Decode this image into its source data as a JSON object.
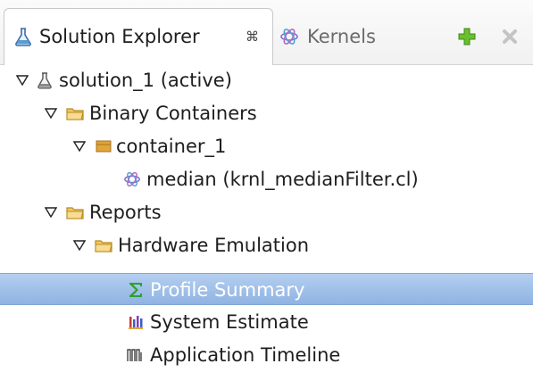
{
  "tabs": {
    "solution_explorer": {
      "label": "Solution Explorer",
      "close_glyph": "⌘"
    },
    "kernels": {
      "label": "Kernels"
    }
  },
  "toolbar": {
    "add_icon": "plus-icon",
    "remove_icon": "remove-icon"
  },
  "tree": {
    "items": [
      {
        "label": "solution_1 (active)",
        "icon": "flask-icon",
        "expanded": true
      },
      {
        "label": "Binary Containers",
        "icon": "folder-icon",
        "expanded": true
      },
      {
        "label": "container_1",
        "icon": "container-icon",
        "expanded": true
      },
      {
        "label": "median (krnl_medianFilter.cl)",
        "icon": "kernel-icon"
      },
      {
        "label": "Reports",
        "icon": "folder-icon",
        "expanded": true
      },
      {
        "label": "Hardware Emulation",
        "icon": "folder-icon",
        "expanded": true
      },
      {
        "label": "Profile Summary",
        "icon": "sigma-icon",
        "selected": true
      },
      {
        "label": "System Estimate",
        "icon": "bar-chart-icon"
      },
      {
        "label": "Application Timeline",
        "icon": "timeline-icon"
      }
    ]
  },
  "colors": {
    "selection": "#9dbde8",
    "folder": "#f0c96a",
    "container": "#e0a63a",
    "sigma": "#2da12d",
    "add": "#6abf2e"
  }
}
